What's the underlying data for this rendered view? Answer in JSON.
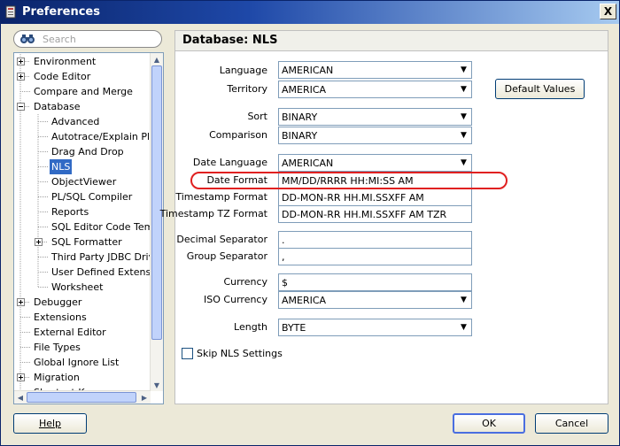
{
  "window": {
    "title": "Preferences",
    "close_label": "X"
  },
  "search": {
    "placeholder": "Search"
  },
  "tree": {
    "items": [
      {
        "label": "Environment",
        "expander": "plus"
      },
      {
        "label": "Code Editor",
        "expander": "plus"
      },
      {
        "label": "Compare and Merge",
        "expander": "none"
      },
      {
        "label": "Database",
        "expander": "minus"
      },
      {
        "label": "Advanced",
        "expander": "none"
      },
      {
        "label": "Autotrace/Explain Plan",
        "expander": "none"
      },
      {
        "label": "Drag And Drop",
        "expander": "none"
      },
      {
        "label": "NLS",
        "expander": "none",
        "selected": true
      },
      {
        "label": "ObjectViewer",
        "expander": "none"
      },
      {
        "label": "PL/SQL Compiler",
        "expander": "none"
      },
      {
        "label": "Reports",
        "expander": "none"
      },
      {
        "label": "SQL Editor Code Templa",
        "expander": "none"
      },
      {
        "label": "SQL Formatter",
        "expander": "plus"
      },
      {
        "label": "Third Party JDBC Driver",
        "expander": "none"
      },
      {
        "label": "User Defined Extension",
        "expander": "none"
      },
      {
        "label": "Worksheet",
        "expander": "none"
      },
      {
        "label": "Debugger",
        "expander": "plus"
      },
      {
        "label": "Extensions",
        "expander": "none"
      },
      {
        "label": "External Editor",
        "expander": "none"
      },
      {
        "label": "File Types",
        "expander": "none"
      },
      {
        "label": "Global Ignore List",
        "expander": "none"
      },
      {
        "label": "Migration",
        "expander": "plus"
      },
      {
        "label": "Shortcut Keys",
        "expander": "none"
      }
    ]
  },
  "panel": {
    "title": "Database: NLS",
    "fields": {
      "language": {
        "label": "Language",
        "value": "AMERICAN"
      },
      "territory": {
        "label": "Territory",
        "value": "AMERICA"
      },
      "sort": {
        "label": "Sort",
        "value": "BINARY"
      },
      "comparison": {
        "label": "Comparison",
        "value": "BINARY"
      },
      "date_language": {
        "label": "Date Language",
        "value": "AMERICAN"
      },
      "date_format": {
        "label": "Date Format",
        "value": "MM/DD/RRRR HH:MI:SS AM"
      },
      "timestamp_format": {
        "label": "Timestamp Format",
        "value": "DD-MON-RR HH.MI.SSXFF AM"
      },
      "timestamp_tz_format": {
        "label": "Timestamp TZ Format",
        "value": "DD-MON-RR HH.MI.SSXFF AM TZR"
      },
      "decimal_separator": {
        "label": "Decimal Separator",
        "value": "."
      },
      "group_separator": {
        "label": "Group Separator",
        "value": ","
      },
      "currency": {
        "label": "Currency",
        "value": "$"
      },
      "iso_currency": {
        "label": "ISO Currency",
        "value": "AMERICA"
      },
      "length": {
        "label": "Length",
        "value": "BYTE"
      }
    },
    "default_values_label": "Default Values",
    "skip_nls_label": "Skip NLS Settings",
    "skip_nls_checked": false
  },
  "footer": {
    "help_label": "Help",
    "ok_label": "OK",
    "cancel_label": "Cancel"
  },
  "colors": {
    "selection": "#316ac5",
    "highlight_ring": "#e02020",
    "title_bar": "#0a246a"
  }
}
